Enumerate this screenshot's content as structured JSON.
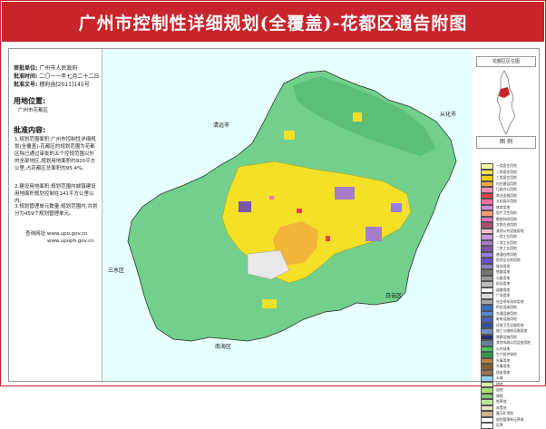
{
  "title": "广州市控制性详细规划(全覆盖)-花都区通告附图",
  "approval": {
    "unit_label": "审批单位:",
    "unit_value": "广州市人民政府",
    "time_label": "批准时间:",
    "time_value": "二〇一一年七月二十二日",
    "doc_label": "批准文号:",
    "doc_value": "穗府函[2011]145号"
  },
  "location": {
    "heading": "用地位置:",
    "value": "广州市花都区"
  },
  "content": {
    "heading": "批准内容:",
    "p1": "1.规划范围面积:广州市控制性详细规划(全覆盖)-花都区的规划范围为花都区除已通过审批的五个控规范围以外的全部地区,规划用地面积约920平方公里,占花都区总面积的95.4%。",
    "p2": "2.建设用地面积:规划范围内城镇建设用地面积规划控制在141平方公里以内。",
    "p3": "3.规划管理单元数量:规划范围内,共划分为459个规划管理单元。",
    "query1": "查询网址:www.upo.gov.cn",
    "query2": "www.upoph.gov.cn"
  },
  "places": {
    "qingyuan": "清远市",
    "conghua": "从化市",
    "sanshui": "三水区",
    "baiyun": "白云区",
    "nanhai": "南海区"
  },
  "right_panel": {
    "locator_title": "花都区区位图",
    "legend_title": "图 例"
  },
  "legend": [
    {
      "label": "一类居住用地",
      "color": "#fff7a0"
    },
    {
      "label": "二类居住用地",
      "color": "#ffe34d"
    },
    {
      "label": "三类居住用地",
      "color": "#f5c800"
    },
    {
      "label": "村庄建设用地",
      "color": "#f2a640"
    },
    {
      "label": "行政办公用地",
      "color": "#ff8db3"
    },
    {
      "label": "商业金融用地",
      "color": "#e8404a"
    },
    {
      "label": "文化娱乐用地",
      "color": "#ff6fa0"
    },
    {
      "label": "体育用地",
      "color": "#d88ad8"
    },
    {
      "label": "医疗卫生用地",
      "color": "#ff9a7a"
    },
    {
      "label": "教育科研用地",
      "color": "#e070c0"
    },
    {
      "label": "文物古迹用地",
      "color": "#b05070"
    },
    {
      "label": "其他公共设施用地",
      "color": "#f6b9d0"
    },
    {
      "label": "一类工业用地",
      "color": "#c49ad8"
    },
    {
      "label": "二类工业用地",
      "color": "#a57cc9"
    },
    {
      "label": "三类工业用地",
      "color": "#7a55a8"
    },
    {
      "label": "普通仓库用地",
      "color": "#9a7ee8"
    },
    {
      "label": "危险品仓库用地",
      "color": "#6a4ed0"
    },
    {
      "label": "堆场用地",
      "color": "#8f80c0"
    },
    {
      "label": "铁路用地",
      "color": "#777777"
    },
    {
      "label": "公路用地",
      "color": "#999999"
    },
    {
      "label": "机场用地",
      "color": "#bbbbbb"
    },
    {
      "label": "道路用地",
      "color": "#ffffff"
    },
    {
      "label": "广场用地",
      "color": "#d8d8d8"
    },
    {
      "label": "社会停车场库用地",
      "color": "#a8a8a8"
    },
    {
      "label": "供应设施用地",
      "color": "#3a70c8"
    },
    {
      "label": "交通设施用地",
      "color": "#5a8ad8"
    },
    {
      "label": "邮电设施用地",
      "color": "#4a60b8"
    },
    {
      "label": "环境卫生设施用地",
      "color": "#3050a0"
    },
    {
      "label": "施工与维修设施用地",
      "color": "#7090c0"
    },
    {
      "label": "殡葬设施用地",
      "color": "#203070"
    },
    {
      "label": "其他市政公用设施用地",
      "color": "#6080a0"
    },
    {
      "label": "公共绿地",
      "color": "#4cc060"
    },
    {
      "label": "生产防护绿地",
      "color": "#2e9a4a"
    },
    {
      "label": "外事用地",
      "color": "#c08040"
    },
    {
      "label": "军事用地",
      "color": "#806030"
    },
    {
      "label": "保安用地",
      "color": "#a07050"
    },
    {
      "label": "水域",
      "color": "#8fd0f0"
    },
    {
      "label": "耕地",
      "color": "#d8f0a0"
    },
    {
      "label": "园地",
      "color": "#a8e070"
    },
    {
      "label": "林地",
      "color": "#88c878"
    },
    {
      "label": "牧草地",
      "color": "#b8e8a0"
    },
    {
      "label": "弃置地",
      "color": "#e8e0c0"
    },
    {
      "label": "露天矿用地",
      "color": "#d0b090"
    },
    {
      "label": "规划管理单元界线",
      "color": "#ffffff"
    },
    {
      "label": "区界",
      "color": "#ffffff"
    }
  ],
  "colors": {
    "title_bar": "#c9242b",
    "outside_land": "#e6ffff",
    "forest": "#72d08c",
    "urban_core": "#f5e028",
    "industrial": "#a57cc9",
    "commercial": "#e8404a",
    "airport": "#e8e8e8"
  }
}
